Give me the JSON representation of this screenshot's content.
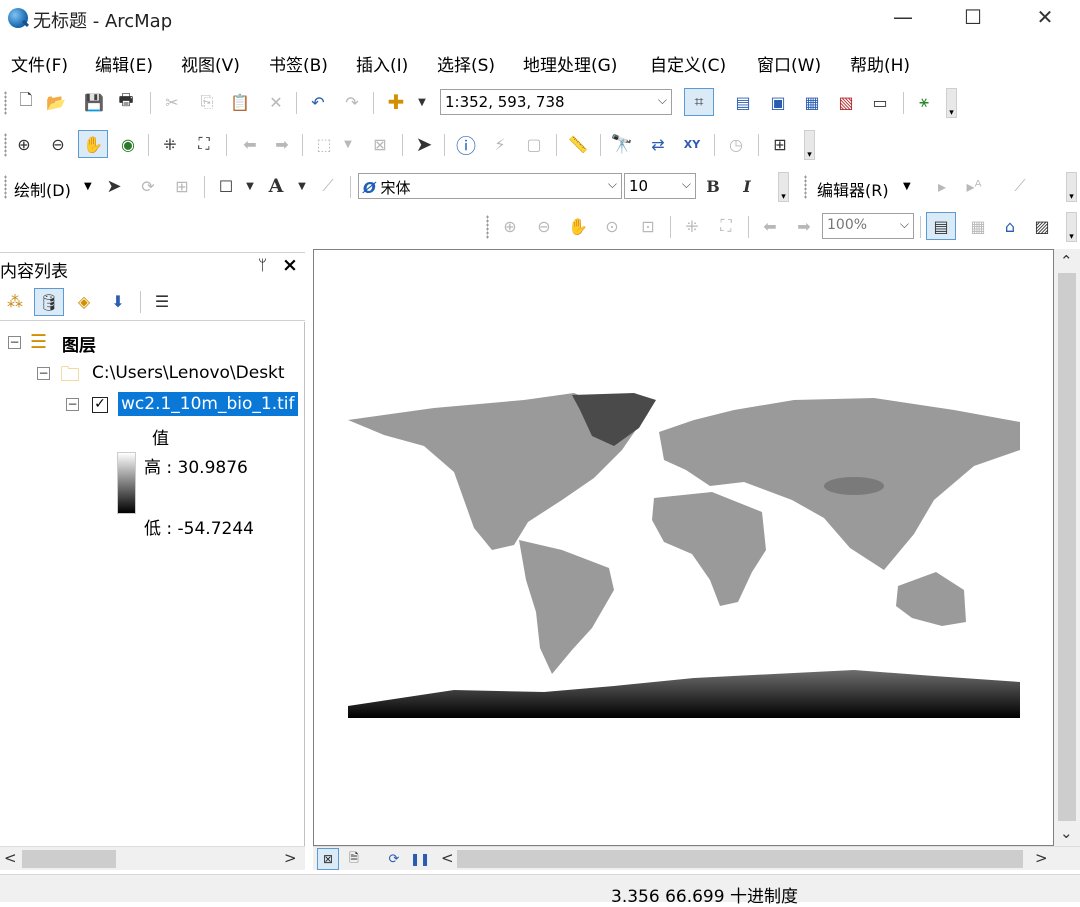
{
  "window": {
    "title": "无标题 - ArcMap",
    "minimize": "—",
    "maximize": "☐",
    "close": "✕"
  },
  "menu": [
    "文件(F)",
    "编辑(E)",
    "视图(V)",
    "书签(B)",
    "插入(I)",
    "选择(S)",
    "地理处理(G)",
    "自定义(C)",
    "窗口(W)",
    "帮助(H)"
  ],
  "toolbar": {
    "scale": "1:352, 593, 738",
    "font_name": "宋体",
    "font_size": "10",
    "draw_label": "绘制(D)",
    "editor_label": "编辑器(R)",
    "bold": "B",
    "italic": "I",
    "text_tool": "A",
    "layout_zoom": "100%"
  },
  "toc": {
    "title": "内容列表",
    "pin": "ᛘ",
    "close": "×",
    "layers_root": "图层",
    "folder": "C:\\Users\\Lenovo\\Deskt",
    "layer": "wc2.1_10m_bio_1.tif",
    "layer_checked": true,
    "legend_field": "值",
    "legend_high": "高 : 30.9876",
    "legend_low": "低 : -54.7244"
  },
  "status": {
    "coordinates": "3.356  66.699 十进制度"
  },
  "icons": {
    "new": "new-document-icon",
    "open": "open-folder-icon",
    "save": "save-icon",
    "print": "print-icon",
    "identify": "identify-icon",
    "find": "binoculars-icon"
  },
  "colors": {
    "selection": "#0a78d7",
    "raster_high": "#ffffff",
    "raster_low": "#000000"
  }
}
